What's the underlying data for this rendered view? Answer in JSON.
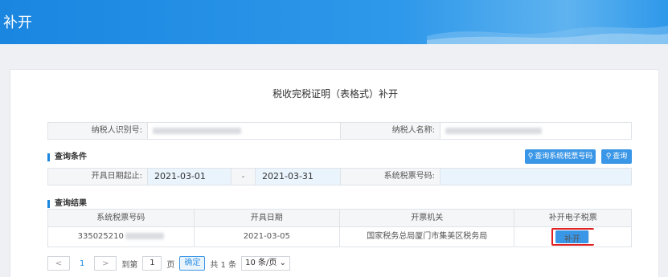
{
  "header": {
    "title": "补开"
  },
  "page": {
    "title": "税收完税证明（表格式）补开"
  },
  "taxpayer": {
    "id_label": "纳税人识别号:",
    "name_label": "纳税人名称:"
  },
  "query": {
    "section_title": "查询条件",
    "btn_query_system": "查询系统税票号码",
    "btn_query": "查询",
    "date_range_label": "开具日期起止:",
    "date_from": "2021-03-01",
    "date_sep": "-",
    "date_to": "2021-03-31",
    "ticket_label": "系统税票号码:",
    "ticket_value": ""
  },
  "results": {
    "section_title": "查询结果",
    "columns": [
      "系统税票号码",
      "开具日期",
      "开票机关",
      "补开电子税票"
    ],
    "rows": [
      {
        "ticket_no": "335025210",
        "date": "2021-03-05",
        "authority": "国家税务总局厦门市集美区税务局",
        "action": "补开"
      }
    ]
  },
  "pager": {
    "prev": "<",
    "page": "1",
    "next": ">",
    "goto_label": "到第",
    "goto_value": "1",
    "page_unit": "页",
    "confirm": "确定",
    "total": "共 1 条",
    "page_size": "10 条/页"
  },
  "colors": {
    "brand": "#1a86e0",
    "button": "#3a96e6",
    "highlight": "#e02020"
  }
}
